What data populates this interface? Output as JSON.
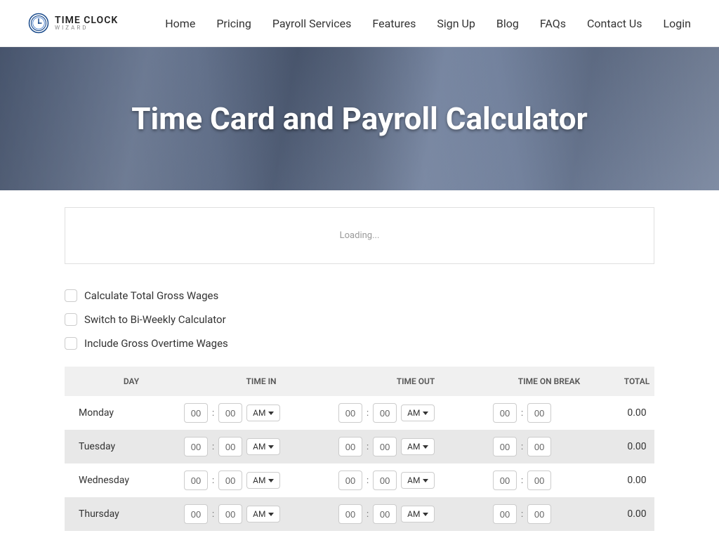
{
  "logo": {
    "title": "TIME CLOCK",
    "sub": "WIZARD"
  },
  "nav": [
    "Home",
    "Pricing",
    "Payroll Services",
    "Features",
    "Sign Up",
    "Blog",
    "FAQs",
    "Contact Us",
    "Login"
  ],
  "hero": {
    "title": "Time Card and Payroll Calculator"
  },
  "loading": "Loading...",
  "options": [
    "Calculate Total Gross Wages",
    "Switch to Bi-Weekly Calculator",
    "Include Gross Overtime Wages"
  ],
  "columns": [
    "DAY",
    "TIME IN",
    "TIME OUT",
    "TIME ON BREAK",
    "TOTAL"
  ],
  "ampm": "AM",
  "zero": "00",
  "rows": [
    {
      "day": "Monday",
      "total": "0.00"
    },
    {
      "day": "Tuesday",
      "total": "0.00"
    },
    {
      "day": "Wednesday",
      "total": "0.00"
    },
    {
      "day": "Thursday",
      "total": "0.00"
    }
  ]
}
